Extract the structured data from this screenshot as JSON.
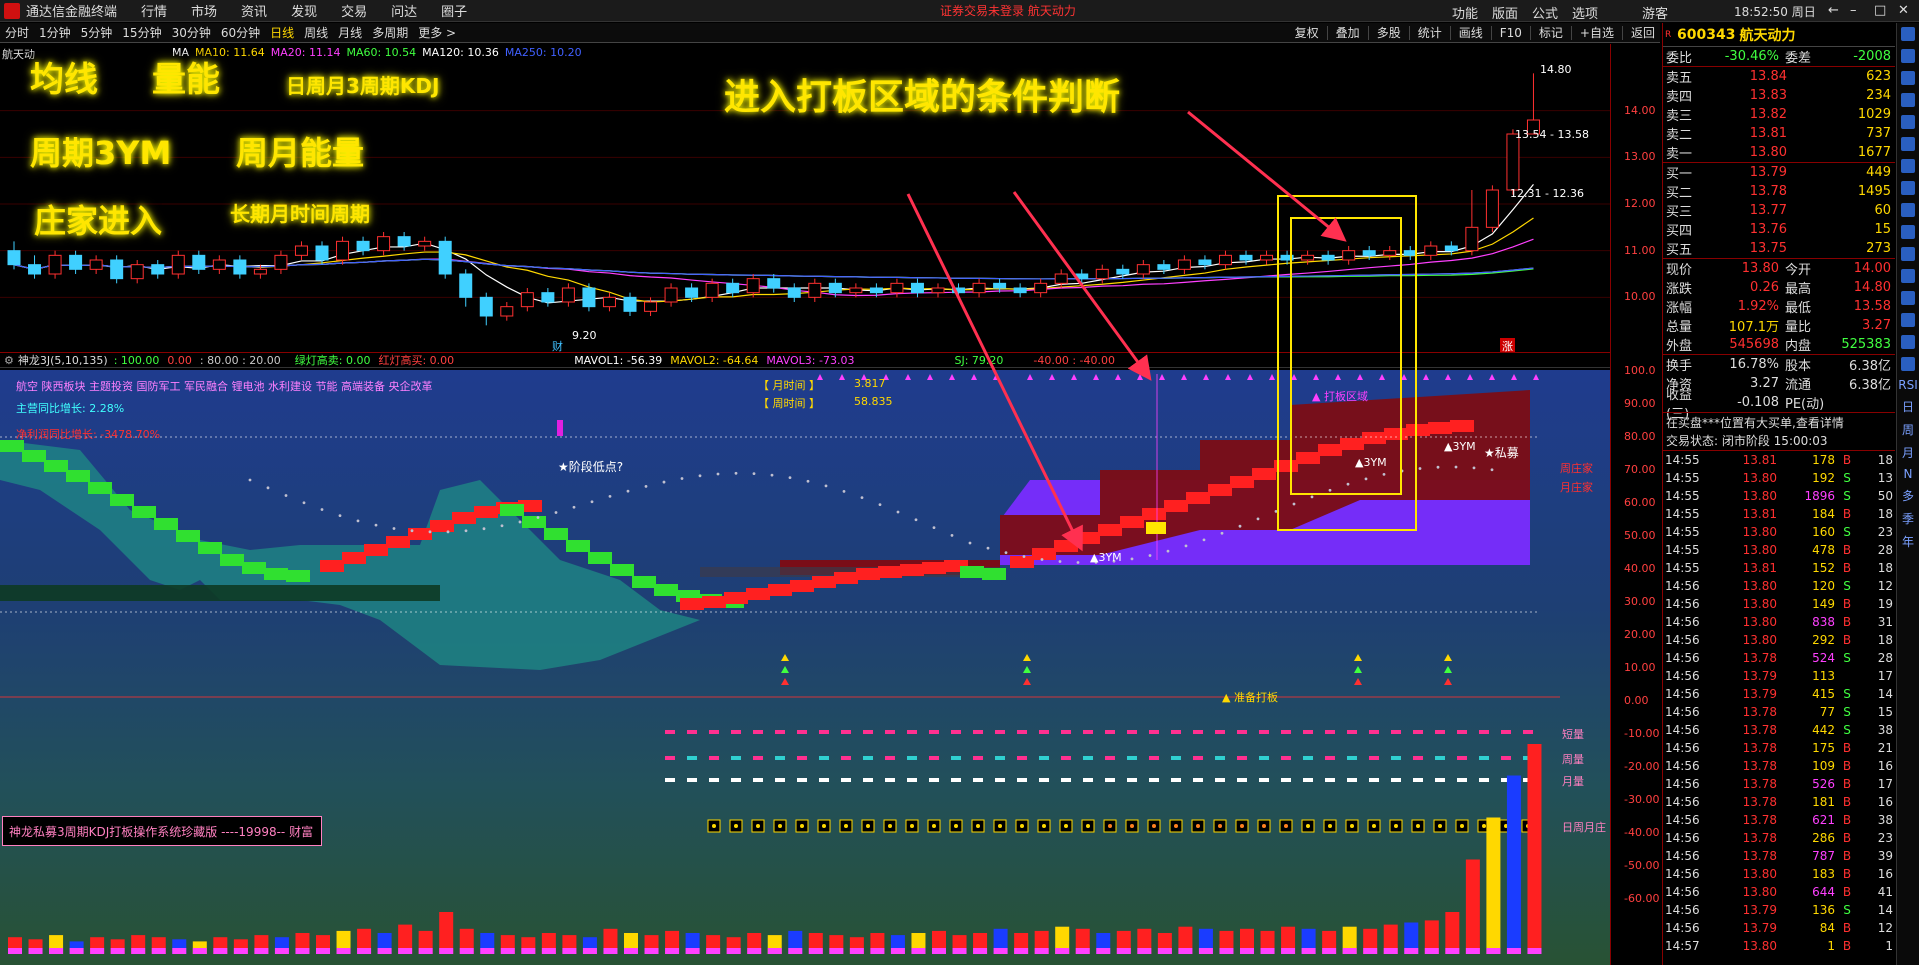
{
  "menubar": {
    "app_name": "通达信金融终端",
    "items": [
      "行情",
      "市场",
      "资讯",
      "发现",
      "交易",
      "问达",
      "圈子"
    ],
    "title": "证券交易未登录  航天动力",
    "right_items": [
      "功能",
      "版面",
      "公式",
      "选项",
      "游客"
    ],
    "clock": "18:52:50 周日"
  },
  "toolbar": {
    "periods": [
      "分时",
      "1分钟",
      "5分钟",
      "15分钟",
      "30分钟",
      "60分钟",
      "日线",
      "周线",
      "月线",
      "多周期",
      "更多 >"
    ],
    "active": "日线",
    "right_tools": [
      "复权",
      "叠加",
      "多股",
      "统计",
      "画线",
      "F10",
      "标记",
      "+自选",
      "返回"
    ]
  },
  "price_chart": {
    "stock_label": "航天动",
    "ma_legend": [
      {
        "text": "MA",
        "color": "#ffffff"
      },
      {
        "text": "MA10: 11.64",
        "color": "#ffd800"
      },
      {
        "text": "MA20: 11.14",
        "color": "#ff40ff"
      },
      {
        "text": "MA60: 10.54",
        "color": "#40ff40"
      },
      {
        "text": "MA120: 10.36",
        "color": "#ffffff"
      },
      {
        "text": "MA250: 10.20",
        "color": "#4060ff"
      }
    ],
    "annotations": {
      "high_value": "14.80",
      "range1": "13.54 - 13.58",
      "range2": "12.31 - 12.36",
      "low_value": "9.20",
      "cai_mark": "财",
      "zhang_mark": "涨"
    },
    "y_ticks": [
      "14.00",
      "13.00",
      "12.00",
      "11.00",
      "10.00"
    ],
    "y_values": [
      14,
      13,
      12,
      11,
      10
    ]
  },
  "overlay_labels": {
    "ma": "均线",
    "volume": "量能",
    "kdj": "日周月3周期KDJ",
    "cycle3ym": "周期3YM",
    "weekmonth_energy": "周月能量",
    "dealer_enter": "庄家进入",
    "long_cycle": "长期月时间周期",
    "entry_condition": "进入打板区域的条件判断"
  },
  "indicator_header": {
    "name": "神龙3J(5,10,135)",
    "values": [
      {
        "text": ": 100.00",
        "color": "#40ff40"
      },
      {
        "text": "0.00",
        "color": "#ff4040"
      },
      {
        "text": ": 80.00 : 20.00",
        "color": "#c8c8c8"
      },
      {
        "text": "绿灯高卖: 0.00",
        "color": "#40ff40"
      },
      {
        "text": "红灯高买: 0.00",
        "color": "#ff4040"
      },
      {
        "text": "MAVOL1: -56.39",
        "color": "#ffffff"
      },
      {
        "text": "MAVOL2: -64.64",
        "color": "#ffd800"
      },
      {
        "text": "MAVOL3: -73.03",
        "color": "#ff40ff"
      },
      {
        "text": "SJ: 79.20",
        "color": "#40ff40"
      },
      {
        "text": "-40.00 : -40.00",
        "color": "#ff4040"
      }
    ]
  },
  "indicator_panel": {
    "sectors": "航空 陕西板块 主题投资 国防军工 军民融合 锂电池 水利建设 节能 高端装备 央企改革",
    "growth_label": "主营同比增长:",
    "growth_value": "2.28%",
    "profit_label": "净利润同比增长:",
    "profit_value": "-3478.70%",
    "month_time_label": "【 月时间 】",
    "month_time_value": "3.817",
    "week_time_label": "【 周时间 】",
    "week_time_value": "58.835",
    "stage_low": "★阶段低点?",
    "board_zone": "▲ 打板区域",
    "private_fund": "★私募",
    "week_dealer": "周庄家",
    "month_dealer": "月庄家",
    "prepare_board": "▲ 准备打板",
    "short_amount": "短量",
    "week_amount": "周量",
    "month_amount": "月量",
    "dwm_dealer": "日周月庄",
    "ym_tag": "▲3YM",
    "system_name": "神龙私募3周期KDJ打板操作系统珍藏版 ----19998-- 财富"
  },
  "indicator_y_ticks": [
    "100.0",
    "90.00",
    "80.00",
    "70.00",
    "60.00",
    "50.00",
    "40.00",
    "30.00",
    "20.00",
    "10.00",
    "0.00",
    "-10.00",
    "-20.00",
    "-30.00",
    "-40.00",
    "-50.00",
    "-60.00"
  ],
  "quote_panel": {
    "code": "600343",
    "name": "航天动力",
    "weibi_label": "委比",
    "weibi_value": "-30.46%",
    "weicha_label": "委差",
    "weicha_value": "-2008",
    "sell": [
      {
        "label": "卖五",
        "price": "13.84",
        "vol": "623"
      },
      {
        "label": "卖四",
        "price": "13.83",
        "vol": "234"
      },
      {
        "label": "卖三",
        "price": "13.82",
        "vol": "1029"
      },
      {
        "label": "卖二",
        "price": "13.81",
        "vol": "737"
      },
      {
        "label": "卖一",
        "price": "13.80",
        "vol": "1677"
      }
    ],
    "buy": [
      {
        "label": "买一",
        "price": "13.79",
        "vol": "449"
      },
      {
        "label": "买二",
        "price": "13.78",
        "vol": "1495"
      },
      {
        "label": "买三",
        "price": "13.77",
        "vol": "60"
      },
      {
        "label": "买四",
        "price": "13.76",
        "vol": "15"
      },
      {
        "label": "买五",
        "price": "13.75",
        "vol": "273"
      }
    ],
    "stats": [
      {
        "l1": "现价",
        "v1": "13.80",
        "l2": "今开",
        "v2": "14.00"
      },
      {
        "l1": "涨跌",
        "v1": "0.26",
        "l2": "最高",
        "v2": "14.80"
      },
      {
        "l1": "涨幅",
        "v1": "1.92%",
        "l2": "最低",
        "v2": "13.58"
      },
      {
        "l1": "总量",
        "v1": "107.1万",
        "l2": "量比",
        "v2": "3.27"
      },
      {
        "l1": "外盘",
        "v1": "545698",
        "l2": "内盘",
        "v2": "525383"
      }
    ],
    "stats2": [
      {
        "l1": "换手",
        "v1": "16.78%",
        "l2": "股本",
        "v2": "6.38亿"
      },
      {
        "l1": "净资",
        "v1": "3.27",
        "l2": "流通",
        "v2": "6.38亿"
      },
      {
        "l1": "收益(三)",
        "v1": "-0.108",
        "l2": "PE(动)",
        "v2": ""
      }
    ],
    "notice": "在买盘***位置有大买单,查看详情",
    "trade_state": "交易状态: 闭市阶段 15:00:03"
  },
  "ticks": [
    {
      "t": "14:55",
      "p": "13.81",
      "v": "178",
      "bs": "B",
      "n": "18"
    },
    {
      "t": "14:55",
      "p": "13.80",
      "v": "192",
      "bs": "S",
      "n": "13"
    },
    {
      "t": "14:55",
      "p": "13.80",
      "v": "1896",
      "bs": "S",
      "n": "50"
    },
    {
      "t": "14:55",
      "p": "13.81",
      "v": "184",
      "bs": "B",
      "n": "18"
    },
    {
      "t": "14:55",
      "p": "13.80",
      "v": "160",
      "bs": "S",
      "n": "23"
    },
    {
      "t": "14:55",
      "p": "13.80",
      "v": "478",
      "bs": "B",
      "n": "28"
    },
    {
      "t": "14:55",
      "p": "13.81",
      "v": "152",
      "bs": "B",
      "n": "18"
    },
    {
      "t": "14:56",
      "p": "13.80",
      "v": "120",
      "bs": "S",
      "n": "12"
    },
    {
      "t": "14:56",
      "p": "13.80",
      "v": "149",
      "bs": "B",
      "n": "19"
    },
    {
      "t": "14:56",
      "p": "13.80",
      "v": "838",
      "bs": "B",
      "n": "31"
    },
    {
      "t": "14:56",
      "p": "13.80",
      "v": "292",
      "bs": "B",
      "n": "18"
    },
    {
      "t": "14:56",
      "p": "13.78",
      "v": "524",
      "bs": "S",
      "n": "28"
    },
    {
      "t": "14:56",
      "p": "13.79",
      "v": "113",
      "bs": "",
      "n": "17"
    },
    {
      "t": "14:56",
      "p": "13.79",
      "v": "415",
      "bs": "S",
      "n": "14"
    },
    {
      "t": "14:56",
      "p": "13.78",
      "v": "77",
      "bs": "S",
      "n": "15"
    },
    {
      "t": "14:56",
      "p": "13.78",
      "v": "442",
      "bs": "S",
      "n": "38"
    },
    {
      "t": "14:56",
      "p": "13.78",
      "v": "175",
      "bs": "B",
      "n": "21"
    },
    {
      "t": "14:56",
      "p": "13.78",
      "v": "109",
      "bs": "B",
      "n": "16"
    },
    {
      "t": "14:56",
      "p": "13.78",
      "v": "526",
      "bs": "B",
      "n": "17"
    },
    {
      "t": "14:56",
      "p": "13.78",
      "v": "181",
      "bs": "B",
      "n": "16"
    },
    {
      "t": "14:56",
      "p": "13.78",
      "v": "621",
      "bs": "B",
      "n": "38"
    },
    {
      "t": "14:56",
      "p": "13.78",
      "v": "286",
      "bs": "B",
      "n": "23"
    },
    {
      "t": "14:56",
      "p": "13.78",
      "v": "787",
      "bs": "B",
      "n": "39"
    },
    {
      "t": "14:56",
      "p": "13.80",
      "v": "183",
      "bs": "B",
      "n": "16"
    },
    {
      "t": "14:56",
      "p": "13.80",
      "v": "644",
      "bs": "B",
      "n": "41"
    },
    {
      "t": "14:56",
      "p": "13.79",
      "v": "136",
      "bs": "S",
      "n": "14"
    },
    {
      "t": "14:56",
      "p": "13.79",
      "v": "84",
      "bs": "B",
      "n": "12"
    },
    {
      "t": "14:57",
      "p": "13.80",
      "v": "1",
      "bs": "B",
      "n": "1"
    }
  ],
  "side_icons": [
    "RSI",
    "日",
    "周",
    "月",
    "N",
    "多",
    "季",
    "年"
  ],
  "candles": [
    [
      11.0,
      10.7,
      11.2,
      10.6
    ],
    [
      10.7,
      10.5,
      10.9,
      10.4
    ],
    [
      10.5,
      10.9,
      11.0,
      10.4
    ],
    [
      10.9,
      10.6,
      11.0,
      10.5
    ],
    [
      10.6,
      10.8,
      10.9,
      10.5
    ],
    [
      10.8,
      10.4,
      10.9,
      10.3
    ],
    [
      10.4,
      10.7,
      10.8,
      10.3
    ],
    [
      10.7,
      10.5,
      10.8,
      10.4
    ],
    [
      10.5,
      10.9,
      11.0,
      10.4
    ],
    [
      10.9,
      10.6,
      11.0,
      10.5
    ],
    [
      10.6,
      10.8,
      10.9,
      10.5
    ],
    [
      10.8,
      10.5,
      10.9,
      10.4
    ],
    [
      10.5,
      10.6,
      10.7,
      10.4
    ],
    [
      10.6,
      10.9,
      11.0,
      10.5
    ],
    [
      10.9,
      11.1,
      11.2,
      10.8
    ],
    [
      11.1,
      10.8,
      11.2,
      10.7
    ],
    [
      10.8,
      11.2,
      11.3,
      10.7
    ],
    [
      11.2,
      11.0,
      11.3,
      10.9
    ],
    [
      11.0,
      11.3,
      11.4,
      10.9
    ],
    [
      11.3,
      11.1,
      11.4,
      11.0
    ],
    [
      11.1,
      11.2,
      11.3,
      11.0
    ],
    [
      11.2,
      10.5,
      11.3,
      10.4
    ],
    [
      10.5,
      10.0,
      10.6,
      9.8
    ],
    [
      10.0,
      9.6,
      10.1,
      9.4
    ],
    [
      9.6,
      9.8,
      9.9,
      9.5
    ],
    [
      9.8,
      10.1,
      10.2,
      9.7
    ],
    [
      10.1,
      9.9,
      10.2,
      9.8
    ],
    [
      9.9,
      10.2,
      10.3,
      9.8
    ],
    [
      10.2,
      9.8,
      10.3,
      9.7
    ],
    [
      9.8,
      10.0,
      10.1,
      9.7
    ],
    [
      10.0,
      9.7,
      10.1,
      9.6
    ],
    [
      9.7,
      9.9,
      10.0,
      9.6
    ],
    [
      9.9,
      10.2,
      10.3,
      9.8
    ],
    [
      10.2,
      10.0,
      10.3,
      9.9
    ],
    [
      10.0,
      10.3,
      10.4,
      9.9
    ],
    [
      10.3,
      10.1,
      10.4,
      10.0
    ],
    [
      10.1,
      10.4,
      10.5,
      10.0
    ],
    [
      10.4,
      10.2,
      10.5,
      10.1
    ],
    [
      10.2,
      10.0,
      10.3,
      9.9
    ],
    [
      10.0,
      10.3,
      10.4,
      9.9
    ],
    [
      10.3,
      10.1,
      10.4,
      10.0
    ],
    [
      10.1,
      10.2,
      10.3,
      10.0
    ],
    [
      10.2,
      10.1,
      10.3,
      10.0
    ],
    [
      10.1,
      10.3,
      10.4,
      10.0
    ],
    [
      10.3,
      10.1,
      10.4,
      10.0
    ],
    [
      10.1,
      10.2,
      10.3,
      10.0
    ],
    [
      10.2,
      10.1,
      10.3,
      10.0
    ],
    [
      10.1,
      10.3,
      10.4,
      10.0
    ],
    [
      10.3,
      10.2,
      10.4,
      10.1
    ],
    [
      10.2,
      10.1,
      10.3,
      10.0
    ],
    [
      10.1,
      10.3,
      10.4,
      10.0
    ],
    [
      10.3,
      10.5,
      10.6,
      10.2
    ],
    [
      10.5,
      10.4,
      10.6,
      10.3
    ],
    [
      10.4,
      10.6,
      10.7,
      10.3
    ],
    [
      10.6,
      10.5,
      10.7,
      10.4
    ],
    [
      10.5,
      10.7,
      10.8,
      10.4
    ],
    [
      10.7,
      10.6,
      10.8,
      10.5
    ],
    [
      10.6,
      10.8,
      10.9,
      10.5
    ],
    [
      10.8,
      10.7,
      10.9,
      10.6
    ],
    [
      10.7,
      10.9,
      11.0,
      10.6
    ],
    [
      10.9,
      10.8,
      11.0,
      10.7
    ],
    [
      10.8,
      10.9,
      11.0,
      10.7
    ],
    [
      10.9,
      10.8,
      11.0,
      10.7
    ],
    [
      10.8,
      10.9,
      11.0,
      10.7
    ],
    [
      10.9,
      10.8,
      11.0,
      10.7
    ],
    [
      10.8,
      11.0,
      11.1,
      10.7
    ],
    [
      11.0,
      10.9,
      11.1,
      10.8
    ],
    [
      10.9,
      11.0,
      11.1,
      10.8
    ],
    [
      11.0,
      10.9,
      11.1,
      10.8
    ],
    [
      10.9,
      11.1,
      11.2,
      10.8
    ],
    [
      11.1,
      11.0,
      11.2,
      10.9
    ],
    [
      11.0,
      11.5,
      12.3,
      10.9
    ],
    [
      11.5,
      12.3,
      12.4,
      11.4
    ],
    [
      12.3,
      13.5,
      13.6,
      12.2
    ],
    [
      13.5,
      13.8,
      14.8,
      13.5
    ]
  ],
  "volumes": [
    0.08,
    0.07,
    0.09,
    0.06,
    0.08,
    0.07,
    0.09,
    0.08,
    0.07,
    0.06,
    0.08,
    0.07,
    0.09,
    0.08,
    0.1,
    0.09,
    0.11,
    0.12,
    0.1,
    0.14,
    0.11,
    0.2,
    0.12,
    0.1,
    0.09,
    0.08,
    0.1,
    0.09,
    0.08,
    0.12,
    0.1,
    0.09,
    0.11,
    0.1,
    0.09,
    0.08,
    0.1,
    0.09,
    0.11,
    0.1,
    0.09,
    0.08,
    0.1,
    0.09,
    0.1,
    0.11,
    0.09,
    0.1,
    0.12,
    0.1,
    0.11,
    0.13,
    0.12,
    0.1,
    0.11,
    0.12,
    0.1,
    0.13,
    0.12,
    0.11,
    0.12,
    0.11,
    0.13,
    0.12,
    0.11,
    0.13,
    0.12,
    0.14,
    0.15,
    0.16,
    0.2,
    0.45,
    0.65,
    0.85,
    1.0
  ]
}
